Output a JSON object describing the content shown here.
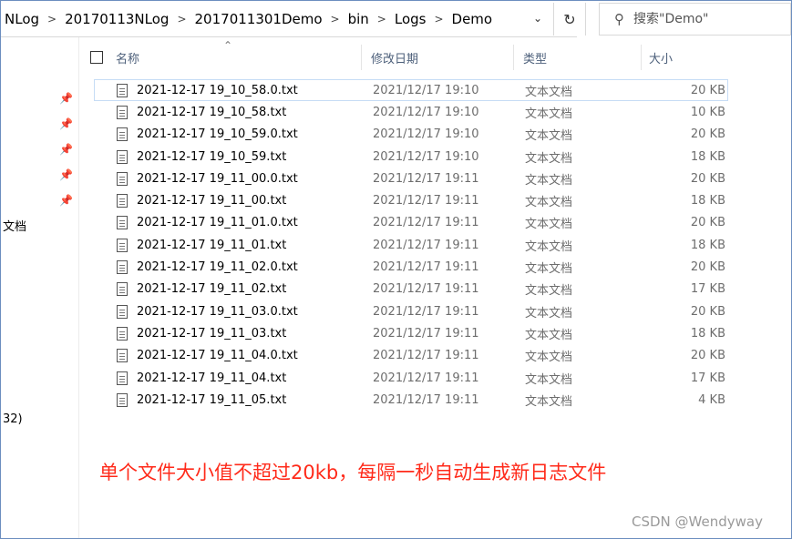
{
  "address_bar": {
    "breadcrumbs": [
      "NLog",
      "20170113NLog",
      "2017011301Demo",
      "bin",
      "Logs",
      "Demo"
    ]
  },
  "search": {
    "placeholder": "搜索\"Demo\""
  },
  "nav_fragments": [
    "文档",
    "32)"
  ],
  "columns": {
    "name": "名称",
    "date": "修改日期",
    "type": "类型",
    "size": "大小"
  },
  "files": [
    {
      "name": "2021-12-17 19_10_58.0.txt",
      "date": "2021/12/17 19:10",
      "type": "文本文档",
      "size": "20 KB"
    },
    {
      "name": "2021-12-17 19_10_58.txt",
      "date": "2021/12/17 19:10",
      "type": "文本文档",
      "size": "10 KB"
    },
    {
      "name": "2021-12-17 19_10_59.0.txt",
      "date": "2021/12/17 19:10",
      "type": "文本文档",
      "size": "20 KB"
    },
    {
      "name": "2021-12-17 19_10_59.txt",
      "date": "2021/12/17 19:10",
      "type": "文本文档",
      "size": "18 KB"
    },
    {
      "name": "2021-12-17 19_11_00.0.txt",
      "date": "2021/12/17 19:11",
      "type": "文本文档",
      "size": "20 KB"
    },
    {
      "name": "2021-12-17 19_11_00.txt",
      "date": "2021/12/17 19:11",
      "type": "文本文档",
      "size": "18 KB"
    },
    {
      "name": "2021-12-17 19_11_01.0.txt",
      "date": "2021/12/17 19:11",
      "type": "文本文档",
      "size": "20 KB"
    },
    {
      "name": "2021-12-17 19_11_01.txt",
      "date": "2021/12/17 19:11",
      "type": "文本文档",
      "size": "18 KB"
    },
    {
      "name": "2021-12-17 19_11_02.0.txt",
      "date": "2021/12/17 19:11",
      "type": "文本文档",
      "size": "20 KB"
    },
    {
      "name": "2021-12-17 19_11_02.txt",
      "date": "2021/12/17 19:11",
      "type": "文本文档",
      "size": "17 KB"
    },
    {
      "name": "2021-12-17 19_11_03.0.txt",
      "date": "2021/12/17 19:11",
      "type": "文本文档",
      "size": "20 KB"
    },
    {
      "name": "2021-12-17 19_11_03.txt",
      "date": "2021/12/17 19:11",
      "type": "文本文档",
      "size": "18 KB"
    },
    {
      "name": "2021-12-17 19_11_04.0.txt",
      "date": "2021/12/17 19:11",
      "type": "文本文档",
      "size": "20 KB"
    },
    {
      "name": "2021-12-17 19_11_04.txt",
      "date": "2021/12/17 19:11",
      "type": "文本文档",
      "size": "17 KB"
    },
    {
      "name": "2021-12-17 19_11_05.txt",
      "date": "2021/12/17 19:11",
      "type": "文本文档",
      "size": "4 KB"
    }
  ],
  "annotation": "单个文件大小值不超过20kb，每隔一秒自动生成新日志文件",
  "watermark": "CSDN @Wendyway",
  "icons": {
    "separator": "chevron-right-icon",
    "dropdown": "chevron-down-icon",
    "refresh": "refresh-icon",
    "search": "search-icon",
    "pin": "pin-icon",
    "file": "text-file-icon"
  },
  "colors": {
    "annotation": "#ff2a1a",
    "header_text": "#4c5f7a",
    "selection_border": "#c6dcf5"
  }
}
